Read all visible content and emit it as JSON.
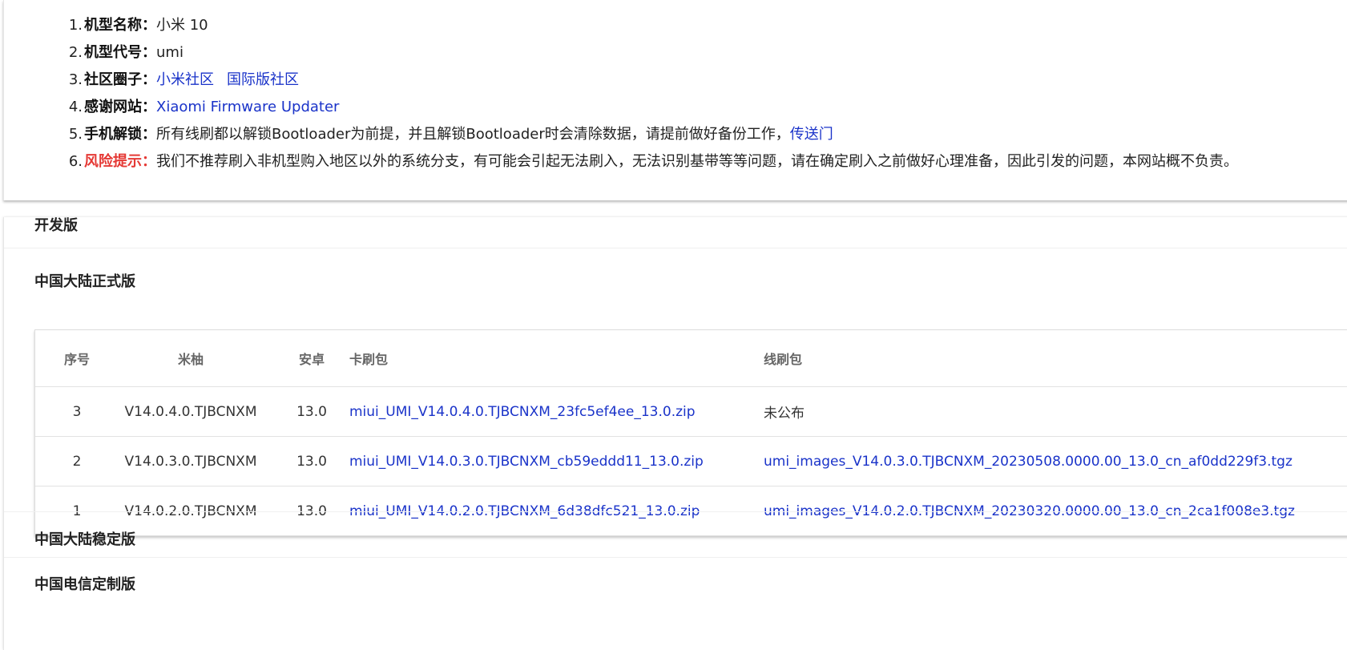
{
  "device_info": [
    {
      "num": "1.",
      "label": "机型名称：",
      "risk": false,
      "text": "小米 10",
      "links": []
    },
    {
      "num": "2.",
      "label": "机型代号：",
      "risk": false,
      "text": "umi",
      "links": []
    },
    {
      "num": "3.",
      "label": "社区圈子：",
      "risk": false,
      "text": "",
      "links": [
        "小米社区",
        "国际版社区"
      ]
    },
    {
      "num": "4.",
      "label": "感谢网站：",
      "risk": false,
      "text": "",
      "links": [
        "Xiaomi Firmware Updater"
      ]
    },
    {
      "num": "5.",
      "label": "手机解锁：",
      "risk": false,
      "text": "所有线刷都以解锁Bootloader为前提，并且解锁Bootloader时会清除数据，请提前做好备份工作，",
      "links": [
        "传送门"
      ]
    },
    {
      "num": "6.",
      "label": "风险提示：",
      "risk": true,
      "text": "我们不推荐刷入非机型购入地区以外的系统分支，有可能会引起无法刷入，无法识别基带等等问题，请在确定刷入之前做好心理准备，因此引发的问题，本网站概不负责。",
      "links": []
    }
  ],
  "sections": {
    "dev": "开发版",
    "cn_stable_official": "中国大陆正式版",
    "cn_stable": "中国大陆稳定版",
    "cn_telecom": "中国电信定制版"
  },
  "table": {
    "headers": {
      "no": "序号",
      "miui": "米柚",
      "android": "安卓",
      "card": "卡刷包",
      "fastboot": "线刷包"
    },
    "rows": [
      {
        "no": "3",
        "miui": "V14.0.4.0.TJBCNXM",
        "android": "13.0",
        "card": "miui_UMI_V14.0.4.0.TJBCNXM_23fc5ef4ee_13.0.zip",
        "fastboot": "未公布",
        "fastboot_is_link": false
      },
      {
        "no": "2",
        "miui": "V14.0.3.0.TJBCNXM",
        "android": "13.0",
        "card": "miui_UMI_V14.0.3.0.TJBCNXM_cb59eddd11_13.0.zip",
        "fastboot": "umi_images_V14.0.3.0.TJBCNXM_20230508.0000.00_13.0_cn_af0dd229f3.tgz",
        "fastboot_is_link": true
      },
      {
        "no": "1",
        "miui": "V14.0.2.0.TJBCNXM",
        "android": "13.0",
        "card": "miui_UMI_V14.0.2.0.TJBCNXM_6d38dfc521_13.0.zip",
        "fastboot": "umi_images_V14.0.2.0.TJBCNXM_20230320.0000.00_13.0_cn_2ca1f008e3.tgz",
        "fastboot_is_link": true
      }
    ]
  },
  "colors": {
    "link": "#1a33c9",
    "risk": "#e53935"
  }
}
